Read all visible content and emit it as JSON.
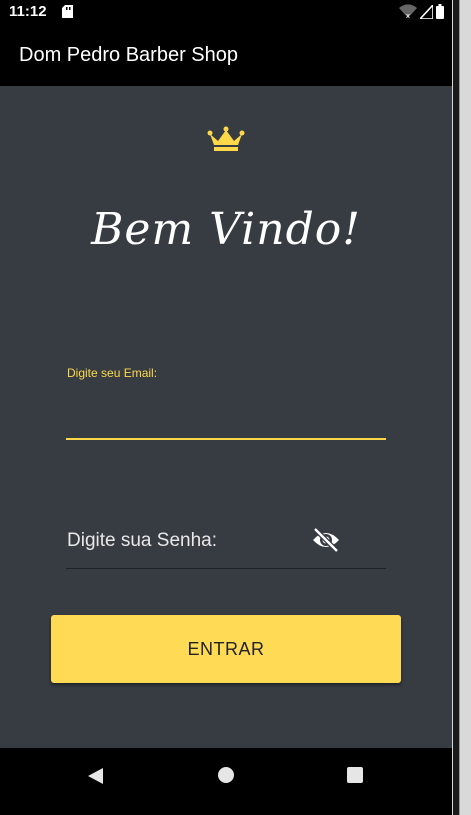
{
  "status_bar": {
    "time": "11:12",
    "icons": [
      "sd-card-icon",
      "wifi-icon",
      "signal-icon",
      "battery-icon"
    ]
  },
  "app_bar": {
    "title": "Dom Pedro Barber Shop"
  },
  "main": {
    "logo_icon": "crown-icon",
    "welcome_text": "Bem Vindo!",
    "email_field": {
      "label": "Digite seu Email:",
      "value": ""
    },
    "password_field": {
      "placeholder": "Digite sua Senha:",
      "toggle_icon": "eye-off-icon"
    },
    "submit_button": {
      "label": "ENTRAR"
    }
  },
  "nav_bar": {
    "icons": [
      "back-icon",
      "home-icon",
      "recents-icon"
    ]
  },
  "colors": {
    "accent": "#ffdb55",
    "background": "#373c43",
    "app_bar": "#000000"
  }
}
